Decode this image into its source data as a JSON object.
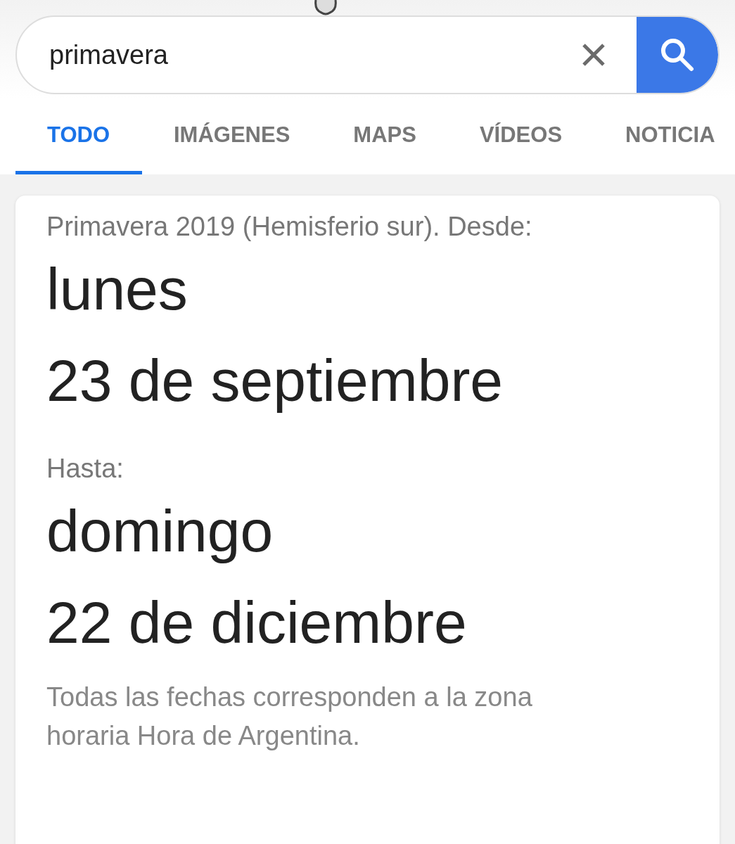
{
  "search": {
    "value": "primavera"
  },
  "tabs": [
    {
      "label": "TODO",
      "selected": true
    },
    {
      "label": "IMÁGENES",
      "selected": false
    },
    {
      "label": "MAPS",
      "selected": false
    },
    {
      "label": "VÍDEOS",
      "selected": false
    },
    {
      "label": "NOTICIA",
      "selected": false
    }
  ],
  "answer": {
    "intro": "Primavera 2019 (Hemisferio sur). Desde:",
    "start_day": "lunes",
    "start_date": "23 de septiembre",
    "until_label": "Hasta:",
    "end_day": "domingo",
    "end_date": "22 de diciembre",
    "note": "Todas las fechas corresponden a la zona horaria Hora de Argentina."
  }
}
